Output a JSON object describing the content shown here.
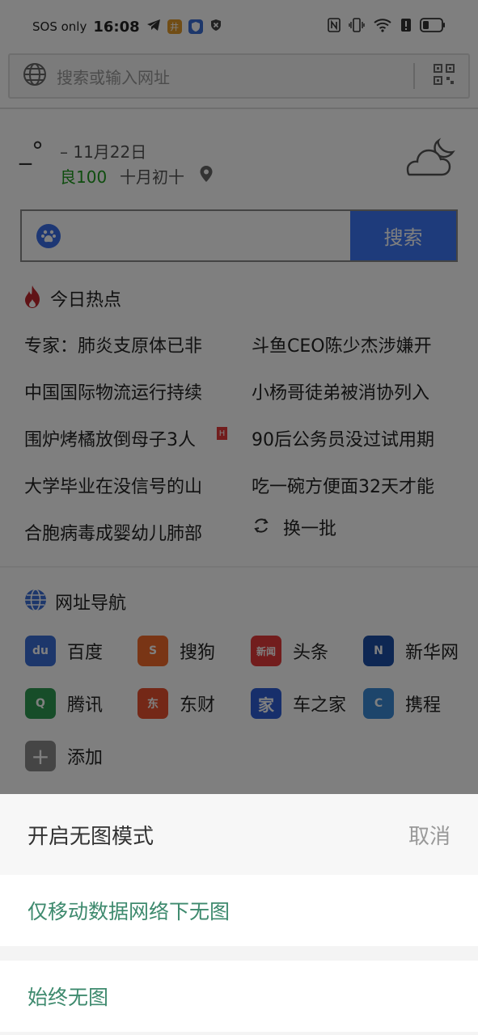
{
  "status": {
    "sos": "SOS only",
    "time": "16:08",
    "app_badge": "井"
  },
  "address": {
    "placeholder": "搜索或输入网址"
  },
  "weather": {
    "temp": "_°",
    "date": "–  11月22日",
    "aqi": "良100",
    "lunar": "十月初十"
  },
  "search": {
    "button": "搜索"
  },
  "hot": {
    "title": "今日热点",
    "items": [
      "专家：肺炎支原体已非",
      "斗鱼CEO陈少杰涉嫌开",
      "中国国际物流运行持续",
      "小杨哥徒弟被消协列入",
      "围炉烤橘放倒母子3人",
      "90后公务员没过试用期",
      "大学毕业在没信号的山",
      "吃一碗方便面32天才能",
      "合胞病毒成婴幼儿肺部"
    ],
    "tag": "H",
    "refresh": "换一批"
  },
  "nav": {
    "title": "网址导航",
    "items": [
      {
        "label": "百度",
        "logo": "du",
        "color": "#3b6fd6"
      },
      {
        "label": "搜狗",
        "logo": "S",
        "color": "#f26a2a"
      },
      {
        "label": "头条",
        "logo": "新闻",
        "color": "#e53b3b"
      },
      {
        "label": "新华网",
        "logo": "N",
        "color": "#1c4fa6"
      },
      {
        "label": "腾讯",
        "logo": "Q",
        "color": "#2f9b52"
      },
      {
        "label": "东财",
        "logo": "东",
        "color": "#e8502e"
      },
      {
        "label": "车之家",
        "logo": "家",
        "color": "#2e5fd6"
      },
      {
        "label": "携程",
        "logo": "C",
        "color": "#3a8ad6"
      },
      {
        "label": "添加",
        "logo": "+",
        "color": "#8a8a8a"
      }
    ]
  },
  "sheet": {
    "title": "开启无图模式",
    "cancel": "取消",
    "options": [
      "仅移动数据网络下无图",
      "始终无图"
    ]
  }
}
